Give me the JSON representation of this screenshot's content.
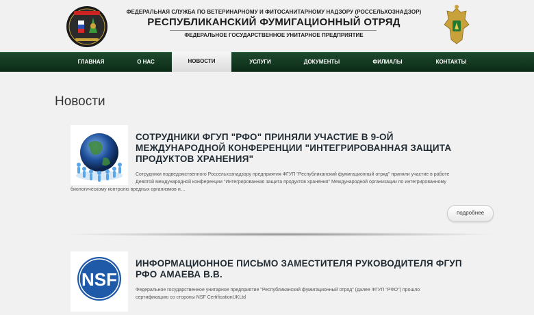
{
  "header": {
    "agency": "ФЕДЕРАЛЬНАЯ СЛУЖБА ПО ВЕТЕРИНАРНОМУ И ФИТОСАНИТАРНОМУ НАДЗОРУ (РОССЕЛЬХОЗНАДЗОР)",
    "org_name": "РЕСПУБЛИКАНСКИЙ ФУМИГАЦИОННЫЙ ОТРЯД",
    "org_type": "ФЕДЕРАЛЬНОЕ ГОСУДАРСТВЕННОЕ УНИТАРНОЕ ПРЕДПРИЯТИЕ",
    "logo_text": "РОССЕЛЬХОЗНАДЗОР"
  },
  "nav": {
    "items": [
      {
        "label": "ГЛАВНАЯ",
        "active": false
      },
      {
        "label": "О НАС",
        "active": false
      },
      {
        "label": "НОВОСТИ",
        "active": true
      },
      {
        "label": "УСЛУГИ",
        "active": false
      },
      {
        "label": "ДОКУМЕНТЫ",
        "active": false
      },
      {
        "label": "ФИЛИАЛЫ",
        "active": false
      },
      {
        "label": "КОНТАКТЫ",
        "active": false
      }
    ]
  },
  "page": {
    "title": "Новости"
  },
  "news": [
    {
      "title": "СОТРУДНИКИ ФГУП \"РФО\" ПРИНЯЛИ УЧАСТИЕ В 9-ОЙ МЕЖДУНАРОДНОЙ КОНФЕРЕНЦИИ \"ИНТЕГРИРОВАННАЯ ЗАЩИТА ПРОДУКТОВ ХРАНЕНИЯ\"",
      "text_line1": "Сотрудники подведомственного Россельхознадзору предприятия ФГУП \"Республиканский фумигационный отряд\" приняли участие в работе",
      "text_line2": "Девятой международной конференции \"Интегрированная защита продуктов хранения\" Международной организации по интегрированному",
      "text_line3": "биологическому контролю вредных организмов и…",
      "more_label": "подробнее"
    },
    {
      "title": "ИНФОРМАЦИОННОЕ ПИСЬМО ЗАМЕСТИТЕЛЯ РУКОВОДИТЕЛЯ ФГУП РФО АМАЕВА В.В.",
      "thumb_text": "NSF",
      "text_line1": "Федеральное государственное унитарное предприятие \"Республиканский фумигационный отряд\" (далее ФГУП \"РФО\") прошло",
      "text_line2": "сертификацию со стороны NSF CertificationUKLtd"
    }
  ],
  "colors": {
    "nav_bg": "#123a20",
    "nsf_blue": "#1e5aa8"
  }
}
